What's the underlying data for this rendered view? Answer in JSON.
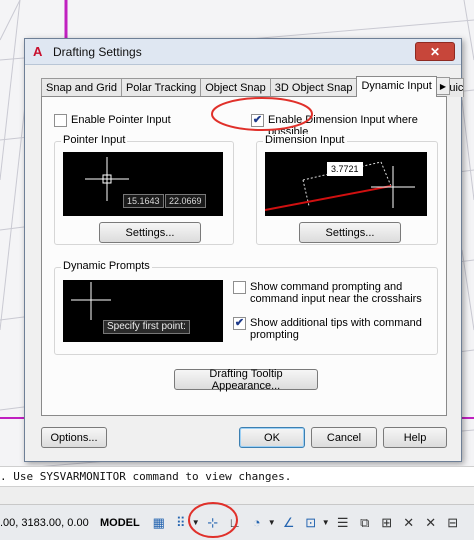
{
  "dialog": {
    "title": "Drafting Settings",
    "app_icon": "A",
    "close_label": "✕"
  },
  "tabs": [
    {
      "label": "Snap and Grid"
    },
    {
      "label": "Polar Tracking"
    },
    {
      "label": "Object Snap"
    },
    {
      "label": "3D Object Snap"
    },
    {
      "label": "Dynamic Input"
    },
    {
      "label": "Quic"
    }
  ],
  "tab_scroll": {
    "left": "◀",
    "right": "▶"
  },
  "pointer": {
    "enable_label": "Enable Pointer Input",
    "enable_checked": false,
    "group_label": "Pointer Input",
    "coord_x": "15.1643",
    "coord_y": "22.0669",
    "settings_label": "Settings..."
  },
  "dimension": {
    "enable_label": "Enable Dimension Input where possible",
    "enable_checked": true,
    "group_label": "Dimension Input",
    "value": "3.7721",
    "settings_label": "Settings..."
  },
  "prompts": {
    "group_label": "Dynamic Prompts",
    "prompt_text": "Specify first point:",
    "show_prompting_label": "Show command prompting and command input near the crosshairs",
    "show_prompting_checked": false,
    "show_tips_label": "Show additional tips with command prompting",
    "show_tips_checked": true
  },
  "tooltip_button": "Drafting Tooltip Appearance...",
  "footer": {
    "options": "Options...",
    "ok": "OK",
    "cancel": "Cancel",
    "help": "Help"
  },
  "command_line": ". Use SYSVARMONITOR command to view changes.",
  "status": {
    "coords": ".00, 3183.00, 0.00",
    "model": "MODEL",
    "icons": [
      "grid-icon",
      "snap-icon",
      "dynamic-input-icon",
      "ortho-icon",
      "polar-icon",
      "isodraft-icon",
      "osnap-icon",
      "lineweight-icon",
      "transparency-icon",
      "selection-cycling-icon",
      "annotation-scale-icon",
      "workspace-icon",
      "units-icon"
    ]
  },
  "colors": {
    "accent": "#3c7fb1",
    "annotation": "#e0302a",
    "dimension_line": "#d01010",
    "canvas_lines": "#c9c9d2",
    "magenta": "#c020c0"
  }
}
